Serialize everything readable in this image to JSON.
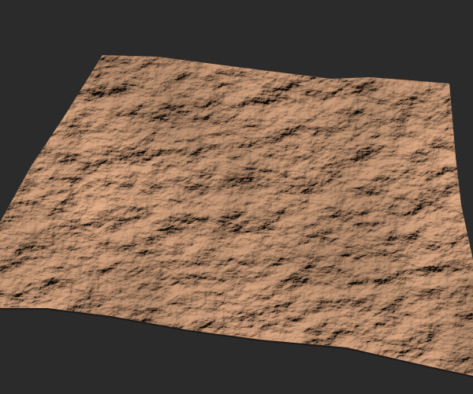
{
  "scene": {
    "background_color": "#2b2b2b",
    "terrain_base_color": "#9a7458",
    "terrain_highlight_color": "#e8d8c4",
    "terrain_shadow_color": "#3a2c24"
  }
}
